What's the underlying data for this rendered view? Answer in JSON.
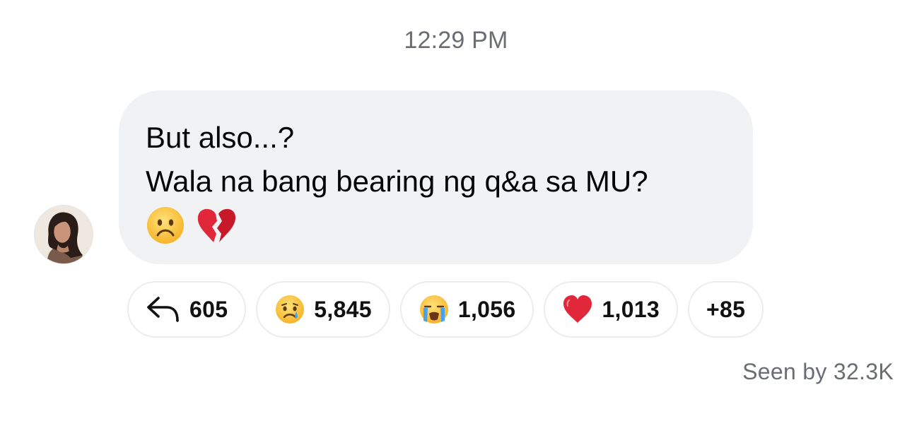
{
  "thread": {
    "timestamp": "12:29 PM",
    "avatar_icon": "profile-photo"
  },
  "message": {
    "lines": [
      "But also...?",
      "Wala na bang bearing ng q&a sa MU?"
    ],
    "emojis": [
      "frowning-face-emoji",
      "broken-heart-emoji"
    ]
  },
  "reactions": [
    {
      "icon": "reply-arrow-icon",
      "count": "605"
    },
    {
      "icon": "crying-face-emoji",
      "count": "5,845"
    },
    {
      "icon": "loudly-crying-face-emoji",
      "count": "1,056"
    },
    {
      "icon": "red-heart-emoji",
      "count": "1,013"
    },
    {
      "icon": "",
      "count": "+85"
    }
  ],
  "footer": {
    "seen_text": "Seen by 32.3K"
  },
  "colors": {
    "bubble_bg": "#f1f2f4",
    "meta_text": "#6a6d72",
    "pill_border": "#ececee"
  }
}
